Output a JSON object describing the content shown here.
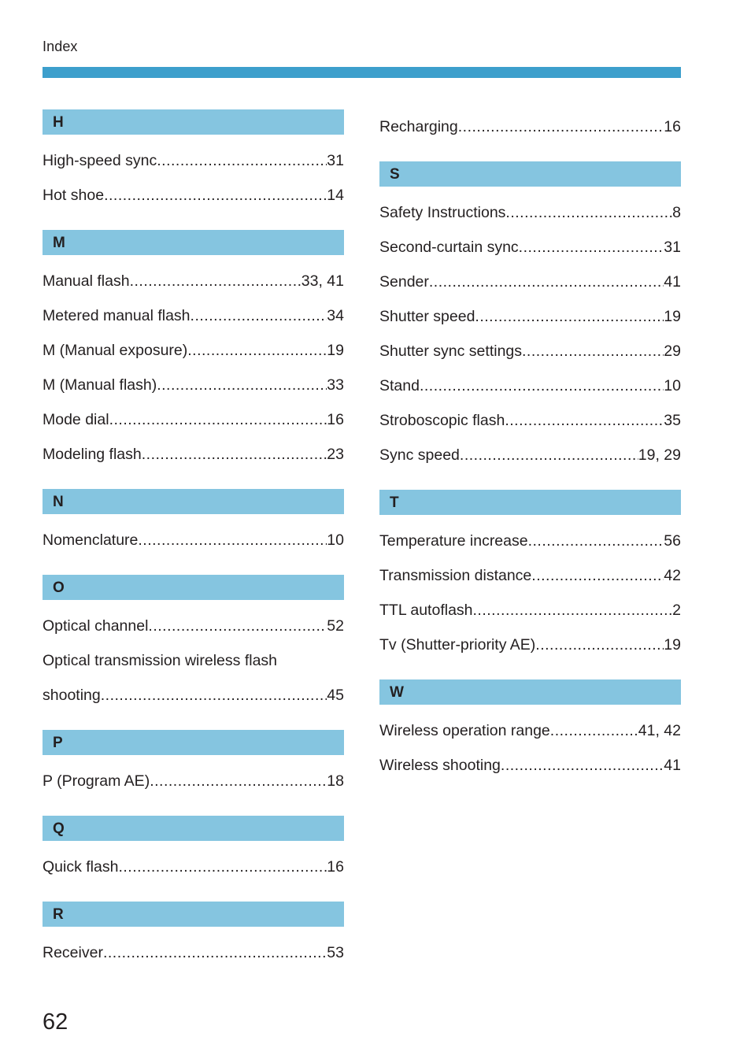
{
  "page": {
    "running_head": "Index",
    "folio": "62",
    "colors": {
      "header_rule": "#3d9fcc",
      "section_bar": "#85c5e0",
      "text": "#231f20",
      "background": "#ffffff"
    }
  },
  "columns": [
    {
      "name": "left",
      "blocks": [
        {
          "type": "section",
          "letter": "H",
          "entries": [
            {
              "term": "High-speed sync",
              "page": "31"
            },
            {
              "term": "Hot shoe ",
              "page": "14"
            }
          ]
        },
        {
          "type": "section",
          "letter": "M",
          "entries": [
            {
              "term": "Manual flash ",
              "page": "33, 41"
            },
            {
              "term": "Metered manual flash",
              "page": "34"
            },
            {
              "term": "M (Manual exposure)",
              "page": "19"
            },
            {
              "term": "M (Manual flash)",
              "page": "33"
            },
            {
              "term": "Mode dial ",
              "page": "16"
            },
            {
              "term": "Modeling flash ",
              "page": "23"
            }
          ]
        },
        {
          "type": "section",
          "letter": "N",
          "entries": [
            {
              "term": "Nomenclature ",
              "page": "10"
            }
          ]
        },
        {
          "type": "section",
          "letter": "O",
          "entries": [
            {
              "term": "Optical channel",
              "page": "52"
            },
            {
              "term": "Optical transmission wireless flash",
              "page": "",
              "wrap_first": true
            },
            {
              "term": "shooting ",
              "page": "45"
            }
          ]
        },
        {
          "type": "section",
          "letter": "P",
          "entries": [
            {
              "term": "P (Program AE) ",
              "page": "18"
            }
          ]
        },
        {
          "type": "section",
          "letter": "Q",
          "entries": [
            {
              "term": "Quick flash",
              "page": "16"
            }
          ]
        },
        {
          "type": "section",
          "letter": "R",
          "entries": [
            {
              "term": "Receiver ",
              "page": "53"
            }
          ]
        }
      ]
    },
    {
      "name": "right",
      "blocks": [
        {
          "type": "orphan-entries",
          "entries": [
            {
              "term": "Recharging ",
              "page": "16"
            }
          ]
        },
        {
          "type": "section",
          "letter": "S",
          "entries": [
            {
              "term": "Safety Instructions ",
              "page": "8"
            },
            {
              "term": "Second-curtain sync",
              "page": "31"
            },
            {
              "term": "Sender ",
              "page": "41"
            },
            {
              "term": "Shutter speed ",
              "page": "19"
            },
            {
              "term": "Shutter sync settings ",
              "page": "29"
            },
            {
              "term": "Stand ",
              "page": "10"
            },
            {
              "term": "Stroboscopic flash ",
              "page": "35"
            },
            {
              "term": "Sync speed",
              "page": "19, 29"
            }
          ]
        },
        {
          "type": "section",
          "letter": "T",
          "entries": [
            {
              "term": "Temperature increase",
              "page": "56"
            },
            {
              "term": "Transmission distance",
              "page": "42"
            },
            {
              "term": "TTL autoflash",
              "page": "2"
            },
            {
              "term": "Tv (Shutter-priority AE)",
              "page": "19"
            }
          ]
        },
        {
          "type": "section",
          "letter": "W",
          "entries": [
            {
              "term": "Wireless operation range",
              "page": "41, 42"
            },
            {
              "term": "Wireless shooting ",
              "page": "41"
            }
          ]
        }
      ]
    }
  ]
}
